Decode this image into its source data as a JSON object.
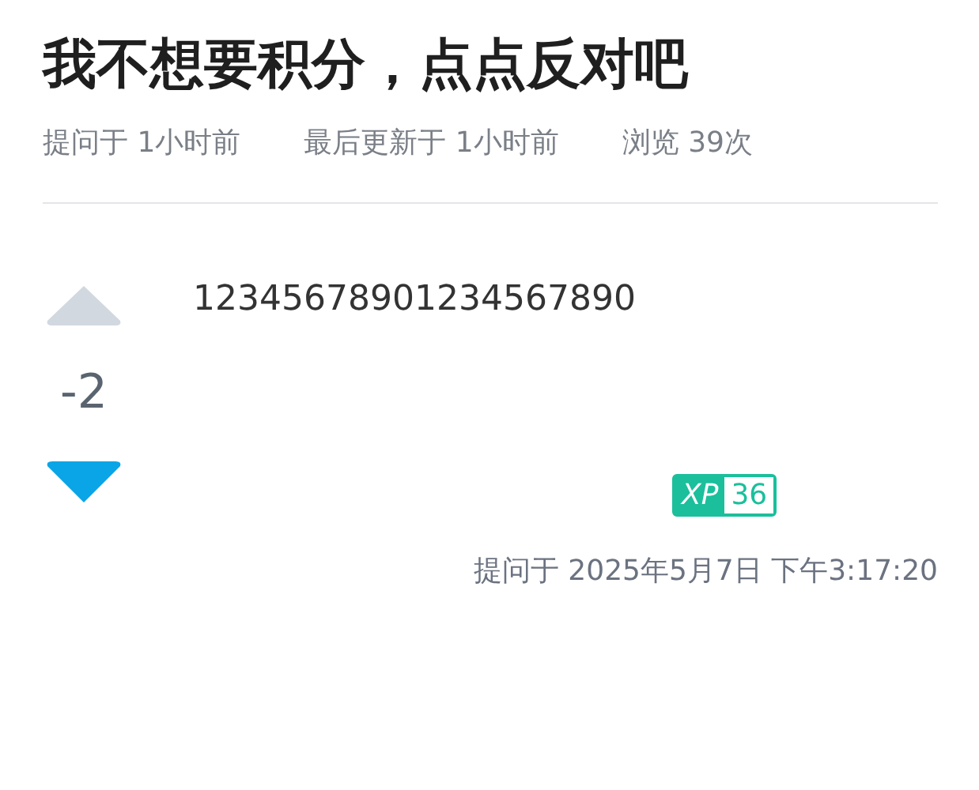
{
  "title": "我不想要积分，点点反对吧",
  "meta": [
    "提问于 1小时前",
    "最后更新于 1小时前",
    "浏览 39次"
  ],
  "votes": {
    "upvote": {
      "selected": false
    },
    "score": "-2",
    "downvote": {
      "selected": true
    }
  },
  "body": "12345678901234567890",
  "xp_badge": {
    "label": "XP",
    "value": "36"
  },
  "asked_at": "提问于 2025年5月7日 下午3:17:20"
}
